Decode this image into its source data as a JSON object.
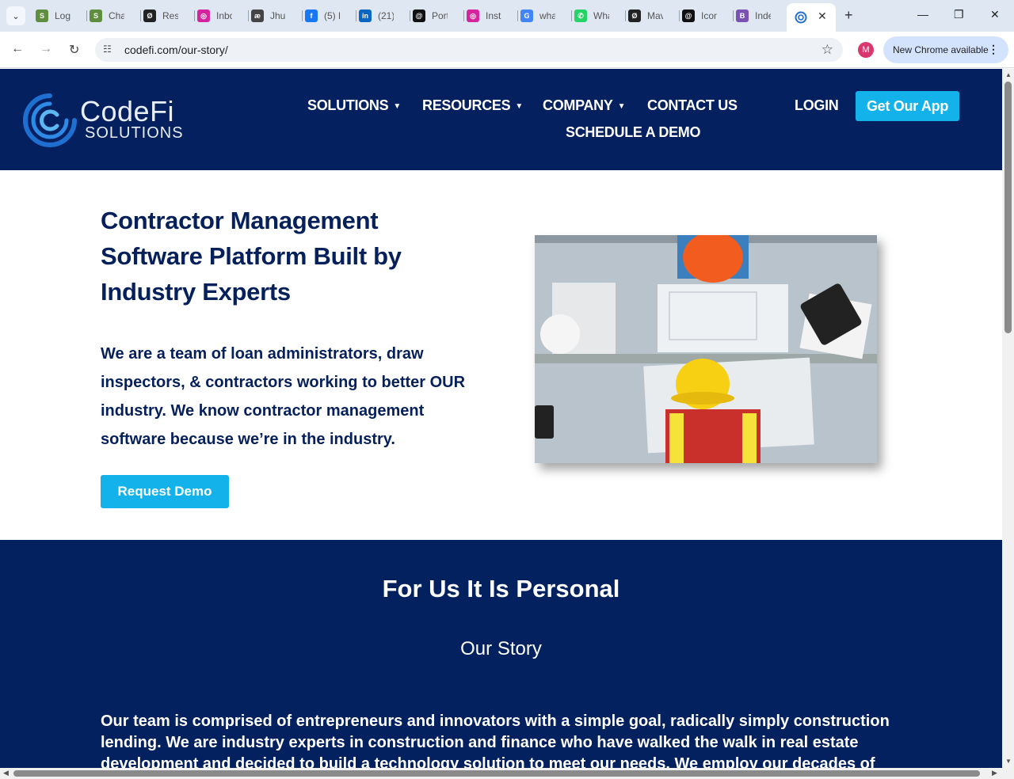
{
  "browser": {
    "tabs": [
      {
        "title": "Log",
        "icon": "shopify-icon",
        "color": "#5e8e3e",
        "glyph": "S"
      },
      {
        "title": "Cha",
        "icon": "shopify-icon",
        "color": "#5e8e3e",
        "glyph": "S"
      },
      {
        "title": "Resu",
        "icon": "loop-icon",
        "color": "#222222",
        "glyph": "Ø"
      },
      {
        "title": "Inbo",
        "icon": "instagram-icon",
        "color": "#d6249f",
        "glyph": "◎"
      },
      {
        "title": "Jhur",
        "icon": "site-icon",
        "color": "#444444",
        "glyph": "æ"
      },
      {
        "title": "(5) F",
        "icon": "facebook-icon",
        "color": "#1877f2",
        "glyph": "f"
      },
      {
        "title": "(21)",
        "icon": "linkedin-icon",
        "color": "#0a66c2",
        "glyph": "in"
      },
      {
        "title": "Port",
        "icon": "threads-icon",
        "color": "#111111",
        "glyph": "@"
      },
      {
        "title": "Inst",
        "icon": "instagram-icon",
        "color": "#d6249f",
        "glyph": "◎"
      },
      {
        "title": "wha",
        "icon": "google-icon",
        "color": "#4285f4",
        "glyph": "G"
      },
      {
        "title": "Wha",
        "icon": "whatsapp-icon",
        "color": "#25d366",
        "glyph": "✆"
      },
      {
        "title": "Mav",
        "icon": "loop-icon",
        "color": "#222222",
        "glyph": "Ø"
      },
      {
        "title": "Icon",
        "icon": "threads-icon",
        "color": "#111111",
        "glyph": "@"
      },
      {
        "title": "Inde",
        "icon": "bootstrap-icon",
        "color": "#7952b3",
        "glyph": "B"
      }
    ],
    "active_tab_icon": "codefi-icon",
    "url": "codefi.com/our-story/",
    "profile_initial": "M",
    "update_label": "New Chrome available"
  },
  "header": {
    "logo_word": "CodeFi",
    "logo_sub": "SOLUTIONS",
    "nav": {
      "solutions": "SOLUTIONS",
      "resources": "RESOURCES",
      "company": "COMPANY",
      "contact": "CONTACT US",
      "schedule": "SCHEDULE A DEMO",
      "login": "LOGIN",
      "app": "Get Our App"
    }
  },
  "hero": {
    "title": "Contractor Management Software Platform Built by Industry Experts",
    "text": "We are a team of loan administrators, draw inspectors, & contractors working to better OUR industry. We know contractor management software because we’re in the industry.",
    "button": "Request Demo"
  },
  "story": {
    "title": "For Us It Is Personal",
    "subtitle": "Our Story",
    "body": "Our team is comprised of entrepreneurs and innovators with a simple goal, radically simply construction lending. We are industry experts in construction and finance who have walked the walk in real estate development and decided to build a technology solution to meet our needs. We employ our decades of"
  },
  "colors": {
    "navy": "#04205f",
    "accent": "#14b2ea"
  }
}
